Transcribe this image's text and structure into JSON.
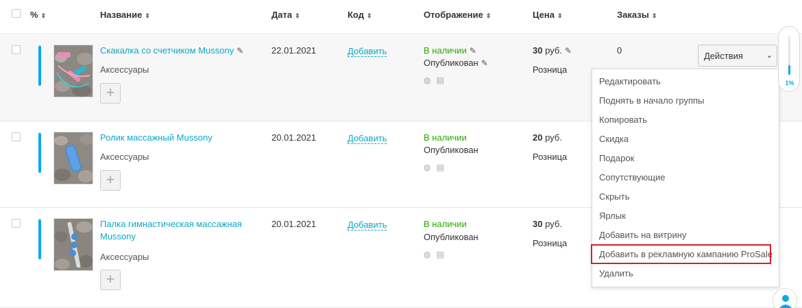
{
  "header": {
    "percent": "%",
    "name": "Название",
    "date": "Дата",
    "code": "Код",
    "display": "Отображение",
    "price": "Цена",
    "orders": "Заказы",
    "sort_icon": "⇕"
  },
  "rows": [
    {
      "name": "Скакалка со счетчиком Mussony",
      "category": "Аксессуары",
      "date": "22.01.2021",
      "code_link": "Добавить",
      "stock": "В наличии",
      "status": "Опубликован",
      "price_value": "30",
      "price_unit": "руб.",
      "price_type": "Розница",
      "orders": "0",
      "progress": 1.0
    },
    {
      "name": "Ролик массажный Mussony",
      "category": "Аксессуары",
      "date": "20.01.2021",
      "code_link": "Добавить",
      "stock": "В наличии",
      "status": "Опубликован",
      "price_value": "20",
      "price_unit": "руб.",
      "price_type": "Розница",
      "orders": "",
      "progress": 1.0
    },
    {
      "name": "Палка гимнастическая массажная Mussony",
      "category": "Аксессуары",
      "date": "20.01.2021",
      "code_link": "Добавить",
      "stock": "В наличии",
      "status": "Опубликован",
      "price_value": "30",
      "price_unit": "руб.",
      "price_type": "Розница",
      "orders": "",
      "progress": 1.0
    }
  ],
  "actions": {
    "label": "Действия",
    "menu": [
      "Редактировать",
      "Поднять в начало группы",
      "Копировать",
      "Скидка",
      "Подарок",
      "Сопутствующие",
      "Скрыть",
      "Ярлык",
      "Добавить на витрину",
      "Добавить в рекламную кампанию ProSale",
      "Удалить"
    ],
    "highlighted_index": 9
  },
  "scroll": {
    "label": "1%",
    "value_percent": 1
  },
  "colors": {
    "accent": "#0aa9c8",
    "progress": "#0aa9ec",
    "in_stock": "#2aa700",
    "highlight_border": "#d0202a"
  },
  "icons": {
    "edit": "pencil-icon",
    "globe": "globe-icon",
    "store": "store-icon",
    "plus": "plus-icon",
    "dropdown": "chevron-down-icon",
    "help": "user-help-icon"
  }
}
